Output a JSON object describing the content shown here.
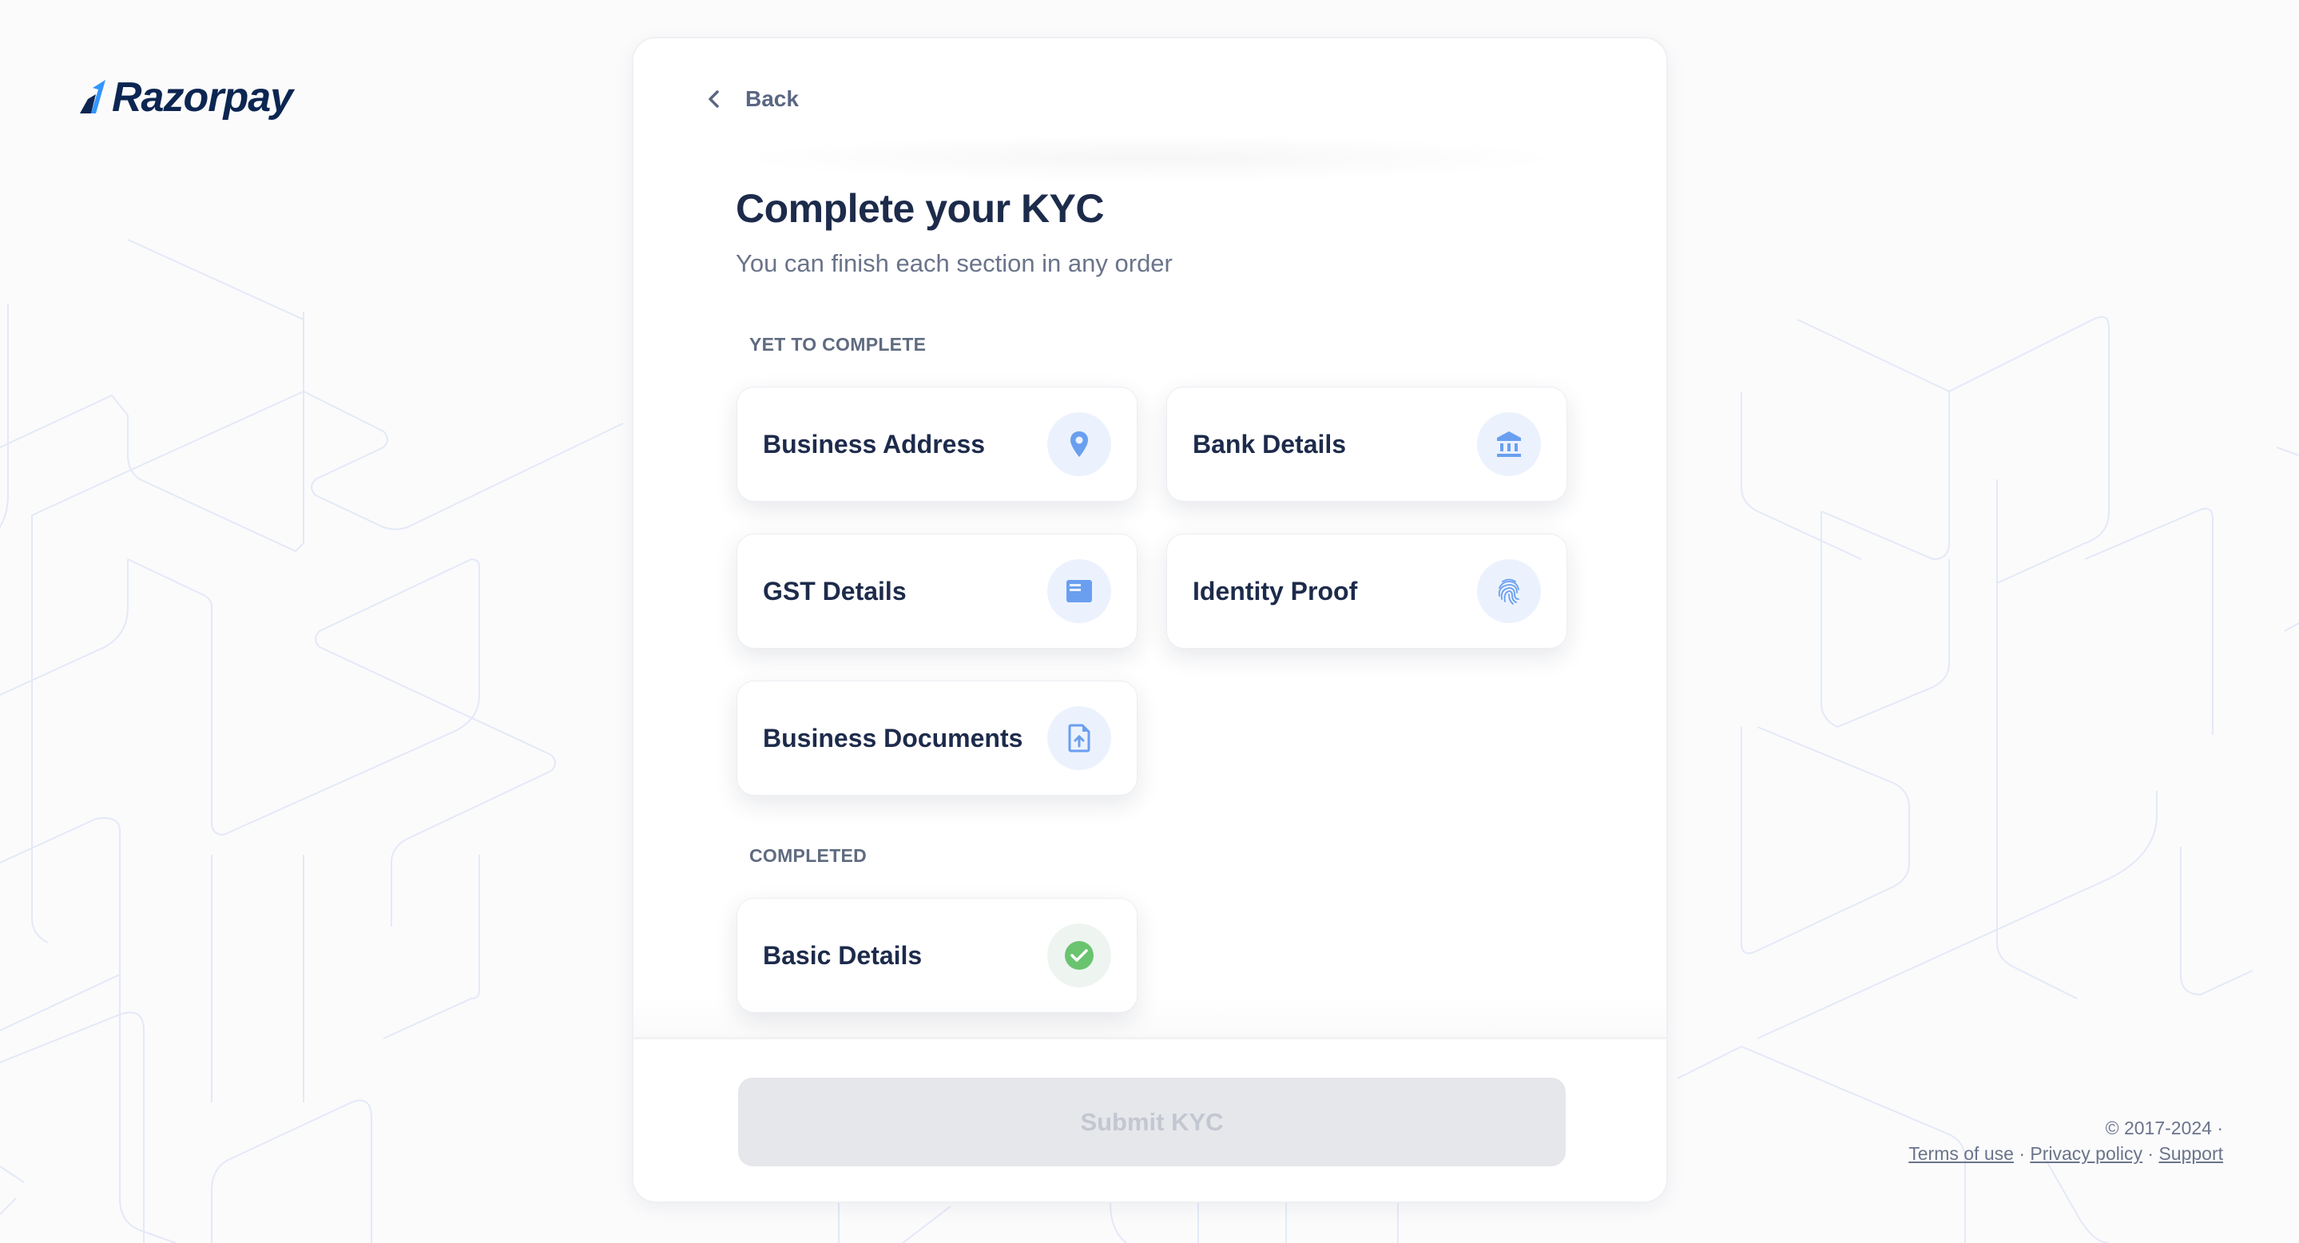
{
  "brand": {
    "name": "Razorpay",
    "logo_icon": "razorpay-logo-icon"
  },
  "header": {
    "back_label": "Back",
    "back_icon": "chevron-left-icon"
  },
  "main": {
    "title": "Complete your KYC",
    "subtitle": "You can finish each section in any order"
  },
  "sections": {
    "pending": {
      "label": "YET TO COMPLETE",
      "items": [
        {
          "label": "Business Address",
          "icon": "location-pin-icon",
          "status": "pending"
        },
        {
          "label": "Bank Details",
          "icon": "bank-icon",
          "status": "pending"
        },
        {
          "label": "GST Details",
          "icon": "card-document-icon",
          "status": "pending"
        },
        {
          "label": "Identity Proof",
          "icon": "fingerprint-icon",
          "status": "pending"
        },
        {
          "label": "Business Documents",
          "icon": "file-upload-icon",
          "status": "pending"
        }
      ]
    },
    "completed": {
      "label": "COMPLETED",
      "items": [
        {
          "label": "Basic Details",
          "icon": "check-circle-icon",
          "status": "completed"
        }
      ]
    }
  },
  "actions": {
    "submit_label": "Submit KYC",
    "submit_enabled": false
  },
  "footer": {
    "copyright": "© 2017-2024 ·",
    "links": [
      "Terms of use",
      "Privacy policy",
      "Support"
    ],
    "separator": "·"
  },
  "colors": {
    "brand_dark": "#0c2651",
    "brand_blue": "#3395ff",
    "icon_blue": "#6a9ff0",
    "success_green": "#6ac46f",
    "text_primary": "#1d2b4b",
    "text_secondary": "#6a748a",
    "button_disabled_bg": "#e6e7eb"
  }
}
